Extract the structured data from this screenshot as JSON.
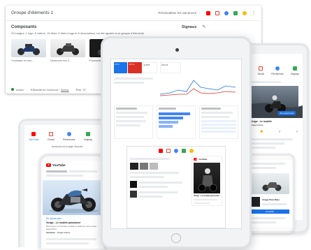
{
  "panel": {
    "title": "Groupe d'éléments 1",
    "preview_label": "Prévisualiser les annonces",
    "components_title": "Composants",
    "components_desc": "20 images, 1 logo, 5 vidéos, 15 titres, 5 titres longs et 5 descriptions ont été ajoutés à ce groupe d'éléments",
    "signals_title": "Signaux",
    "thumbs": [
      {
        "caption": "Conduisez en tout..."
      },
      {
        "caption": "Découvrez nos 2..."
      },
      {
        "caption": "Puissance..."
      }
    ],
    "status": "Activé",
    "efficacite_label": "Efficacité de l'annonce :",
    "efficacite_value": "Bonne",
    "etat_label": "État :",
    "etat_value": "Él"
  },
  "left_ipad": {
    "channels": [
      "YouTube",
      "Gmail",
      "Recherche",
      "Display",
      "Dé"
    ],
    "active_channel": "YouTube",
    "note": "Annonces sur la page d'accueil"
  },
  "phone": {
    "logo": "YouTube",
    "ad_label": "En savoir plus",
    "ad_title": "Virage - Le modèle passionné",
    "ad_desc": "Découvrez le nouveau modèle et réservez votre essai aujourd'hui",
    "ad_brand_label": "Annonce",
    "ad_brand": "Virage France"
  },
  "right_ipad": {
    "channels": [
      "YouTube",
      "Gmail",
      "Recherche",
      "Display"
    ],
    "cta": "En savoir plus",
    "caption_title": "Virage - Le modèle",
    "caption_brand": "Virage France"
  },
  "right_phone": {
    "title": "Virage Piste Moto",
    "cta": "OUVRIR"
  },
  "center": {
    "kpis": [
      {
        "value": "2,5 k",
        "color": "#1a73e8"
      },
      {
        "value": "15,2 k",
        "color": "#d93025"
      },
      {
        "value": "2,25 €",
        "color": "#ffffff"
      },
      {
        "value": "14,6 %",
        "color": "#ffffff"
      }
    ],
    "mobile_title": "YouTube",
    "mobile_caption": "Virage - Le modèle passionné"
  },
  "colors": {
    "yt_red": "#ff0000",
    "gmail_red": "#ea4335",
    "google_blue": "#4285f4",
    "display_green": "#34a853",
    "discover_orange": "#fbbc04",
    "accent_blue": "#1a73e8"
  }
}
